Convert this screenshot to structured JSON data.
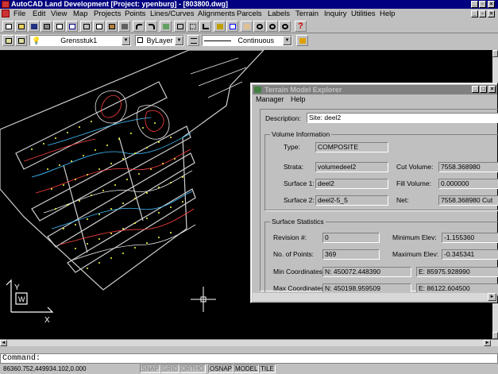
{
  "window": {
    "title": "AutoCAD Land Development [Project: ypenburg] - [803800.dwg]"
  },
  "menu": [
    "File",
    "Edit",
    "View",
    "Map",
    "Projects",
    "Points",
    "Lines/Curves",
    "Alignments",
    "Parcels",
    "Labels",
    "Terrain",
    "Inquiry",
    "Utilities",
    "Help"
  ],
  "layers": {
    "layer_name": "Grensstuk1",
    "color": "ByLayer",
    "linetype": "Continuous"
  },
  "command": {
    "prompt": "Command:"
  },
  "status": {
    "coords": "86360.752,449934.102,0.000",
    "toggles": [
      "SNAP",
      "GRID",
      "ORTHO",
      "OSNAP",
      "MODEL",
      "TILE"
    ],
    "active_toggles": [
      "OSNAP",
      "MODEL",
      "TILE"
    ]
  },
  "explorer": {
    "title": "Terrain Model Explorer",
    "menu": [
      "Manager",
      "Help"
    ],
    "description_label": "Description:",
    "description_value": "Site: deel2",
    "volume_group": "Volume Information",
    "type_label": "Type:",
    "type_value": "COMPOSITE",
    "strata_label": "Strata:",
    "strata_value": "volumedeel2",
    "surface1_label": "Surface 1:",
    "surface1_value": "deel2",
    "surface2_label": "Surface 2:",
    "surface2_value": "deel2-5_5",
    "cut_label": "Cut Volume:",
    "cut_value": "7558.368980",
    "fill_label": "Fill Volume:",
    "fill_value": "0.000000",
    "net_label": "Net:",
    "net_value": "7558.368980 Cut",
    "stats_group": "Surface Statistics",
    "revision_label": "Revision #:",
    "revision_value": "0",
    "points_label": "No. of Points:",
    "points_value": "369",
    "min_elev_label": "Minimum Elev:",
    "min_elev_value": "-1.155360",
    "max_elev_label": "Maximum Elev:",
    "max_elev_value": "-0.345341",
    "min_coord_label": "Min Coordinates:",
    "min_coord_n": "N: 450072.448390",
    "min_coord_e": "E: 85975.928990",
    "max_coord_label": "Max Coordinates:",
    "max_coord_n": "N: 450198.959509",
    "max_coord_e": "E: 86122.604500"
  },
  "ucs": {
    "y": "Y",
    "w": "W",
    "x": "X"
  },
  "colors": {
    "titlebar": "#000080",
    "desktop": "#c0c0c0",
    "canvas": "#000000"
  }
}
